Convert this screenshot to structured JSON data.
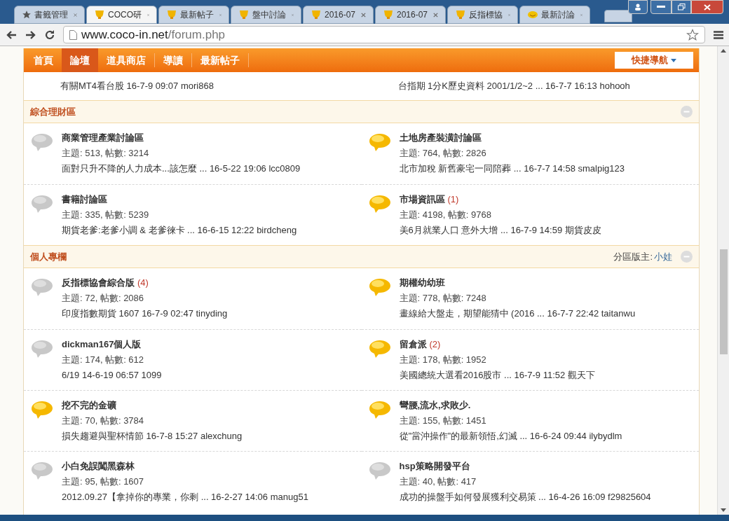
{
  "browser": {
    "tabs": [
      {
        "label": "書籤管理",
        "kind": "bookmarks",
        "selected": false
      },
      {
        "label": "COCO研",
        "kind": "forum",
        "selected": true
      },
      {
        "label": "最新帖子",
        "kind": "forum",
        "selected": false
      },
      {
        "label": "盤中討論",
        "kind": "forum",
        "selected": false
      },
      {
        "label": "2016-07",
        "kind": "forum",
        "selected": false
      },
      {
        "label": "2016-07",
        "kind": "forum",
        "selected": false
      },
      {
        "label": "反指標協",
        "kind": "forum",
        "selected": false
      },
      {
        "label": "最新討論",
        "kind": "discussion",
        "selected": false
      }
    ],
    "url_host": "www.coco-in.net",
    "url_path": "/forum.php"
  },
  "nav": {
    "items": [
      {
        "label": "首頁",
        "selected": false
      },
      {
        "label": "論壇",
        "selected": true
      },
      {
        "label": "道具商店",
        "selected": false
      },
      {
        "label": "導讀",
        "selected": false
      },
      {
        "label": "最新帖子",
        "selected": false
      }
    ],
    "quick_nav": "快捷導航"
  },
  "top_partial": [
    {
      "last_post": "有關MT4看台股 16-7-9 09:07 mori868"
    },
    {
      "last_post": "台指期 1分K歷史資料 2001/1/2~2 ... 16-7-7 16:13 hohooh"
    }
  ],
  "sections": [
    {
      "title": "綜合理財區",
      "forums": [
        {
          "name": "商業管理產業討論區",
          "new": false,
          "stats": "主題: 513, 帖數: 3214",
          "last_post": "面對只升不降的人力成本...該怎麼 ... 16-5-22 19:06 lcc0809"
        },
        {
          "name": "土地房產裝潢討論區",
          "new": true,
          "stats": "主題: 764, 帖數: 2826",
          "last_post": "北市加稅 新舊豪宅一同陪葬 ... 16-7-7 14:58 smalpig123"
        },
        {
          "name": "書籍討論區",
          "new": false,
          "stats": "主題: 335, 帖數: 5239",
          "last_post": "期貨老爹:老爹小調 & 老爹徠卡 ... 16-6-15 12:22 birdcheng"
        },
        {
          "name": "市場資訊區",
          "count": "(1)",
          "new": true,
          "stats": "主題: 4198, 帖數: 9768",
          "last_post": "美6月就業人口 意外大增 ... 16-7-9 14:59 期貨皮皮"
        }
      ]
    },
    {
      "title": "個人專欄",
      "moderator_label": "分區版主:",
      "moderator": "小娃",
      "forums": [
        {
          "name": "反指標協會綜合版",
          "count": "(4)",
          "new": false,
          "stats": "主題: 72, 帖數: 2086",
          "last_post": "印度指數期貨 1607 16-7-9 02:47 tinyding"
        },
        {
          "name": "期權幼幼班",
          "new": true,
          "stats": "主題: 778, 帖數: 7248",
          "last_post": "畫線給大盤走，期望能猜中 (2016 ... 16-7-7 22:42 taitanwu"
        },
        {
          "name": "dickman167個人版",
          "new": false,
          "stats": "主題: 174, 帖數: 612",
          "last_post": "6/19 14-6-19 06:57 1099"
        },
        {
          "name": "留倉派",
          "count": "(2)",
          "new": true,
          "stats": "主題: 178, 帖數: 1952",
          "last_post": "美國總統大選看2016股市 ... 16-7-9 11:52 觀天下"
        },
        {
          "name": "挖不完的金礦",
          "new": true,
          "stats": "主題: 70, 帖數: 3784",
          "last_post": "損失趨避與聖杯情節 16-7-8 15:27 alexchung"
        },
        {
          "name": "彎腰,流水,求敗少.",
          "new": true,
          "stats": "主題: 155, 帖數: 1451",
          "last_post": "從”當沖操作”的最新領悟,幻滅 ... 16-6-24 09:44 ilybydlm"
        },
        {
          "name": "小白免誤闖黑森林",
          "new": false,
          "stats": "主題: 95, 帖數: 1607",
          "last_post": "2012.09.27【拿掉你的專業，你剩 ... 16-2-27 14:06 manug51"
        },
        {
          "name": "hsp策略開發平台",
          "new": false,
          "stats": "主題: 40, 帖數: 417",
          "last_post": "成功的操盤手如何發展獲利交易策 ... 16-4-26 16:09 f29825604"
        }
      ]
    }
  ]
}
